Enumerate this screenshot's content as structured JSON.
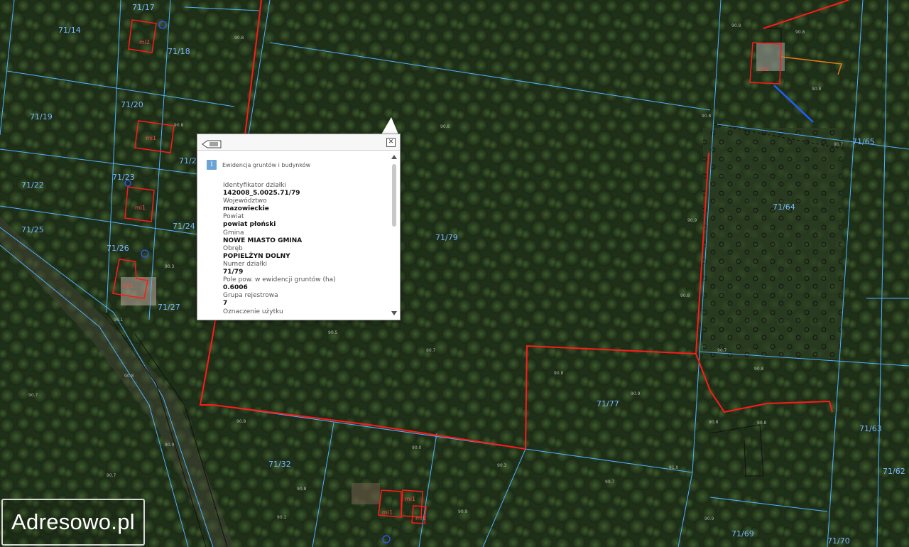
{
  "map": {
    "colors": {
      "parcel_boundary": "#4fb0ff",
      "fence_line": "#ff1a1a",
      "building_outline": "#ff1a1a",
      "parcel_label": "#7ab8ff"
    },
    "parcels": [
      "71/14",
      "71/17",
      "71/18",
      "71/19",
      "71/20",
      "71/2",
      "71/22",
      "71/23",
      "71/24",
      "71/25",
      "71/26",
      "71/27",
      "71/79",
      "71/64",
      "71/65",
      "71/77",
      "71/32",
      "71/63",
      "71/62",
      "71/69",
      "71/70"
    ],
    "buildings": [
      "mi2",
      "mi1",
      "mi1",
      "mi1",
      "mi1",
      "mi2",
      "mi1",
      "mi1"
    ]
  },
  "popup": {
    "back_icon": "list-back-icon",
    "close_icon": "close-icon",
    "info_icon_glyph": "i",
    "title": "Ewidencja gruntów i budynków",
    "fields": [
      {
        "label": "Identyfikator działki",
        "value": "142008_5.0025.71/79"
      },
      {
        "label": "Województwo",
        "value": "mazowieckie"
      },
      {
        "label": "Powiat",
        "value": "powiat płoński"
      },
      {
        "label": "Gmina",
        "value": "NOWE MIASTO GMINA"
      },
      {
        "label": "Obręb",
        "value": "POPIELŻYN DOLNY"
      },
      {
        "label": "Numer działki",
        "value": "71/79"
      },
      {
        "label": "Pole pow. w ewidencji gruntów (ha)",
        "value": "0.6006"
      },
      {
        "label": "Grupa rejestrowa",
        "value": "7"
      },
      {
        "label": "Oznaczenie użytku",
        "value": ""
      }
    ]
  },
  "watermark": {
    "text": "Adresowo.pl"
  }
}
